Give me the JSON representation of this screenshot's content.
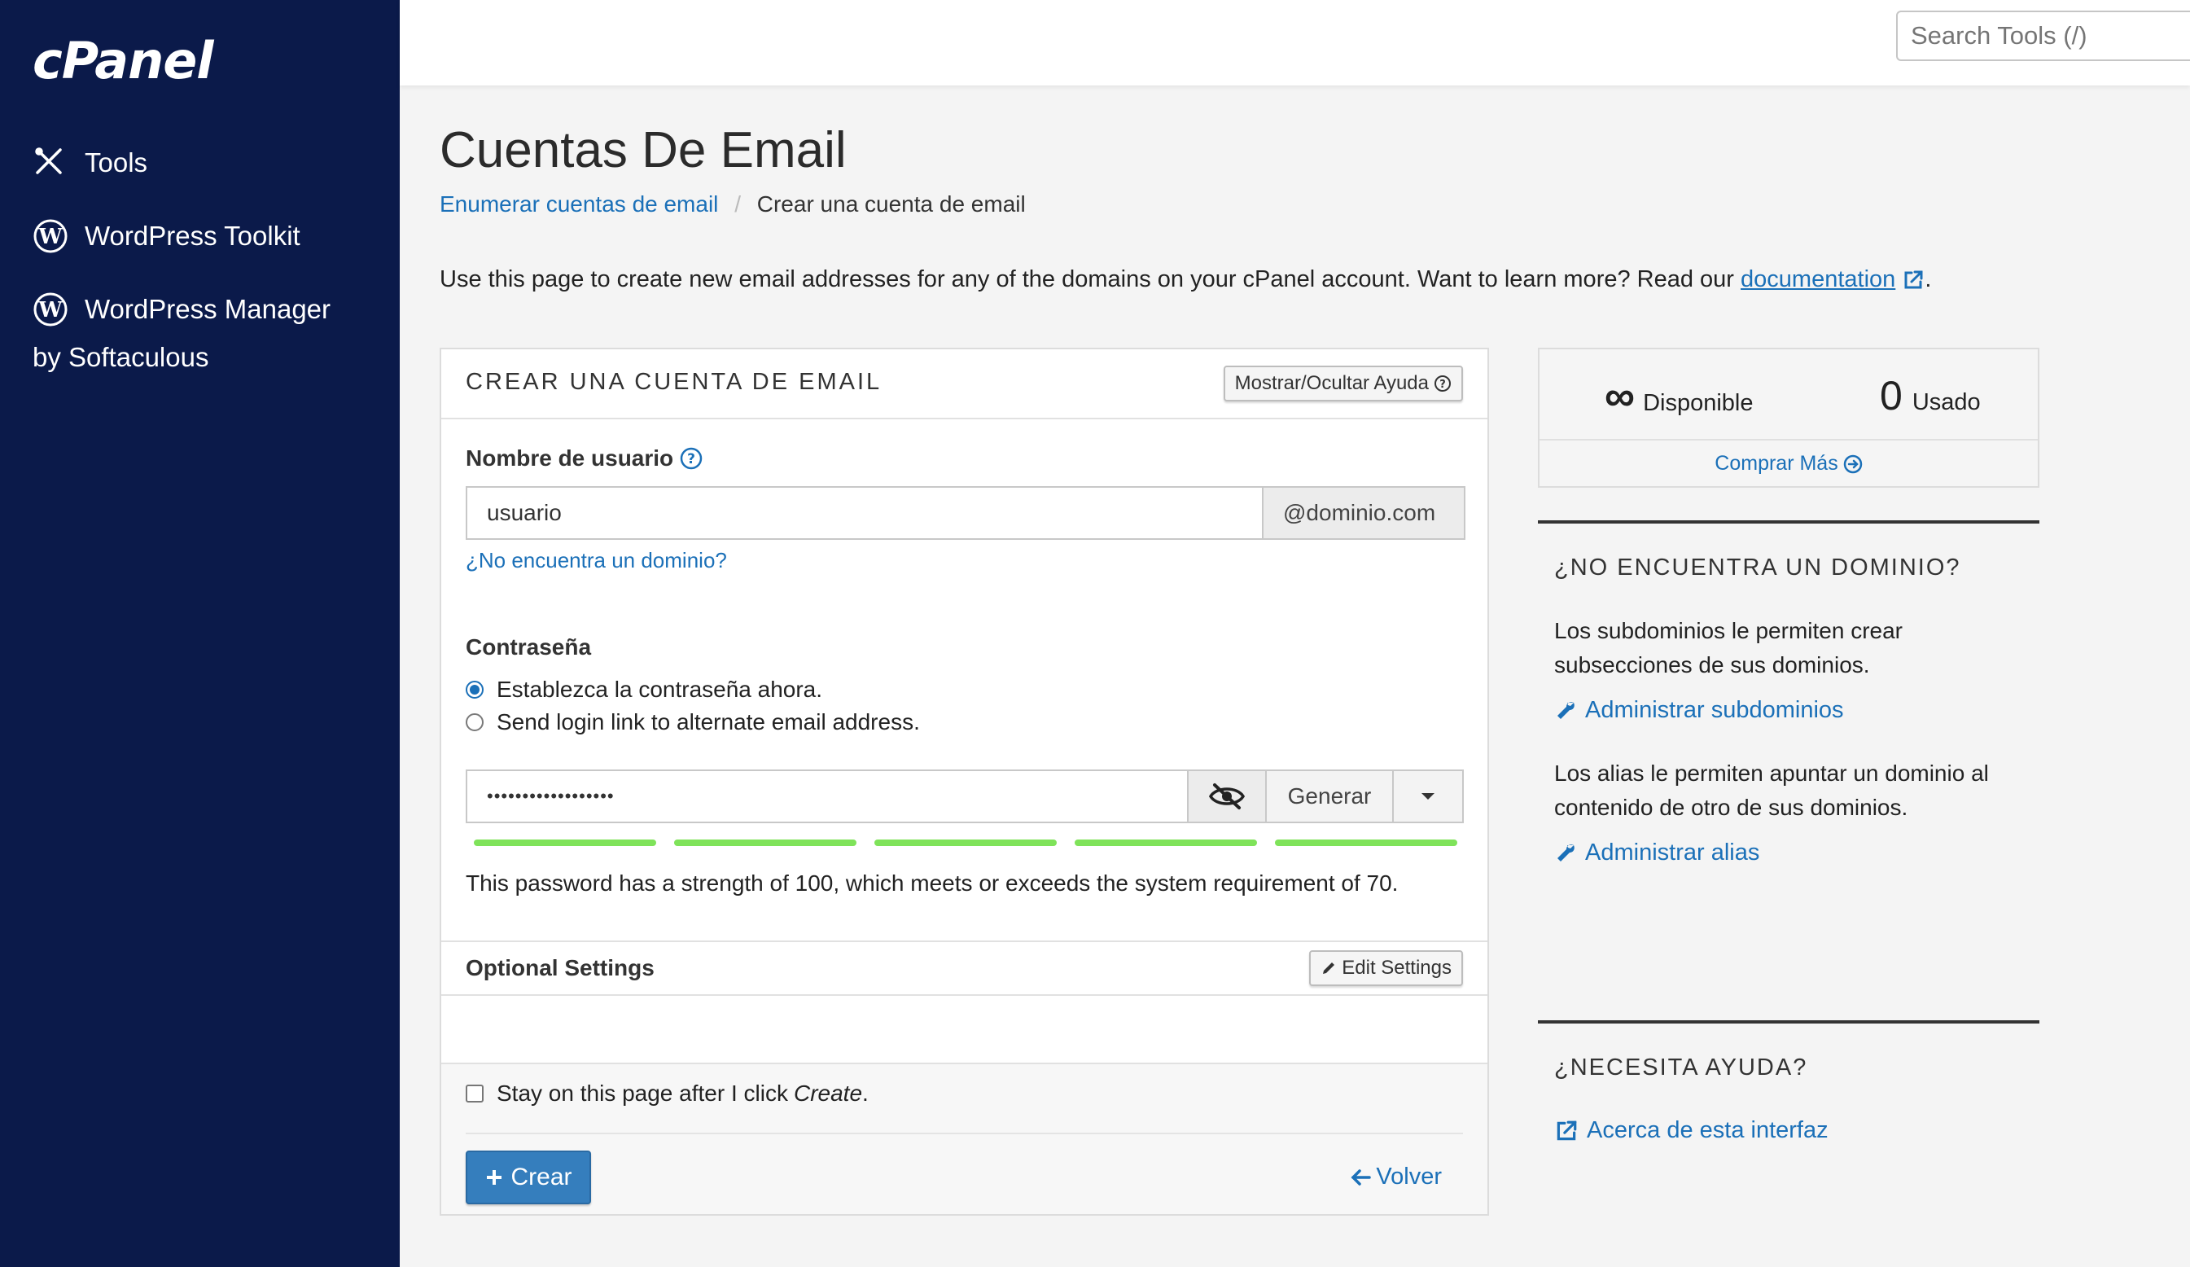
{
  "sidebar": {
    "logo": "cPanel",
    "items": [
      {
        "label": "Tools",
        "icon": "tools-icon"
      },
      {
        "label": "WordPress Toolkit",
        "icon": "wordpress-icon"
      },
      {
        "label": "WordPress Manager",
        "sub": "by Softaculous",
        "icon": "wordpress-icon"
      }
    ]
  },
  "topbar": {
    "search_placeholder": "Search Tools (/)"
  },
  "page": {
    "title": "Cuentas De Email",
    "breadcrumb": {
      "link": "Enumerar cuentas de email",
      "separator": "/",
      "current": "Crear una cuenta de email"
    },
    "intro_text": "Use this page to create new email addresses for any of the domains on your cPanel account. Want to learn more? Read our ",
    "intro_link": "documentation",
    "intro_end": "."
  },
  "form": {
    "title": "CREAR UNA CUENTA DE EMAIL",
    "help_toggle": "Mostrar/Ocultar Ayuda",
    "username_label": "Nombre de usuario",
    "username_value": "usuario",
    "domain_suffix": "@dominio.com",
    "no_domain_link": "¿No encuentra un dominio?",
    "password_label": "Contraseña",
    "radio_set_now": "Establezca la contraseña ahora.",
    "radio_send_link": "Send login link to alternate email address.",
    "password_value": "••••••••••••••••••",
    "generate_label": "Generar",
    "strength_percent": 100,
    "strength_note": "This password has a strength of 100, which meets or exceeds the system requirement of 70.",
    "optional_settings_label": "Optional Settings",
    "edit_settings_label": "Edit Settings",
    "stay_on_page_prefix": "Stay on this page after I click ",
    "stay_on_page_em": "Create",
    "stay_on_page_suffix": ".",
    "create_label": "Crear",
    "back_label": "Volver"
  },
  "stats": {
    "available_value": "∞",
    "available_label": "Disponible",
    "used_value": "0",
    "used_label": "Usado",
    "buy_more": "Comprar Más"
  },
  "right": {
    "no_domain": {
      "heading": "¿NO ENCUENTRA UN DOMINIO?",
      "subdomains_text": "Los subdominios le permiten crear subsecciones de sus dominios.",
      "subdomains_link": "Administrar subdominios",
      "alias_text": "Los alias le permiten apuntar un dominio al contenido de otro de sus dominios.",
      "alias_link": "Administrar alias"
    },
    "help": {
      "heading": "¿NECESITA AYUDA?",
      "about_link": "Acerca de esta interfaz"
    }
  },
  "colors": {
    "sidebar_bg": "#0b1a4a",
    "link": "#1b70b8",
    "primary_button": "#357ebd",
    "strength_bar": "#7fe35a"
  }
}
